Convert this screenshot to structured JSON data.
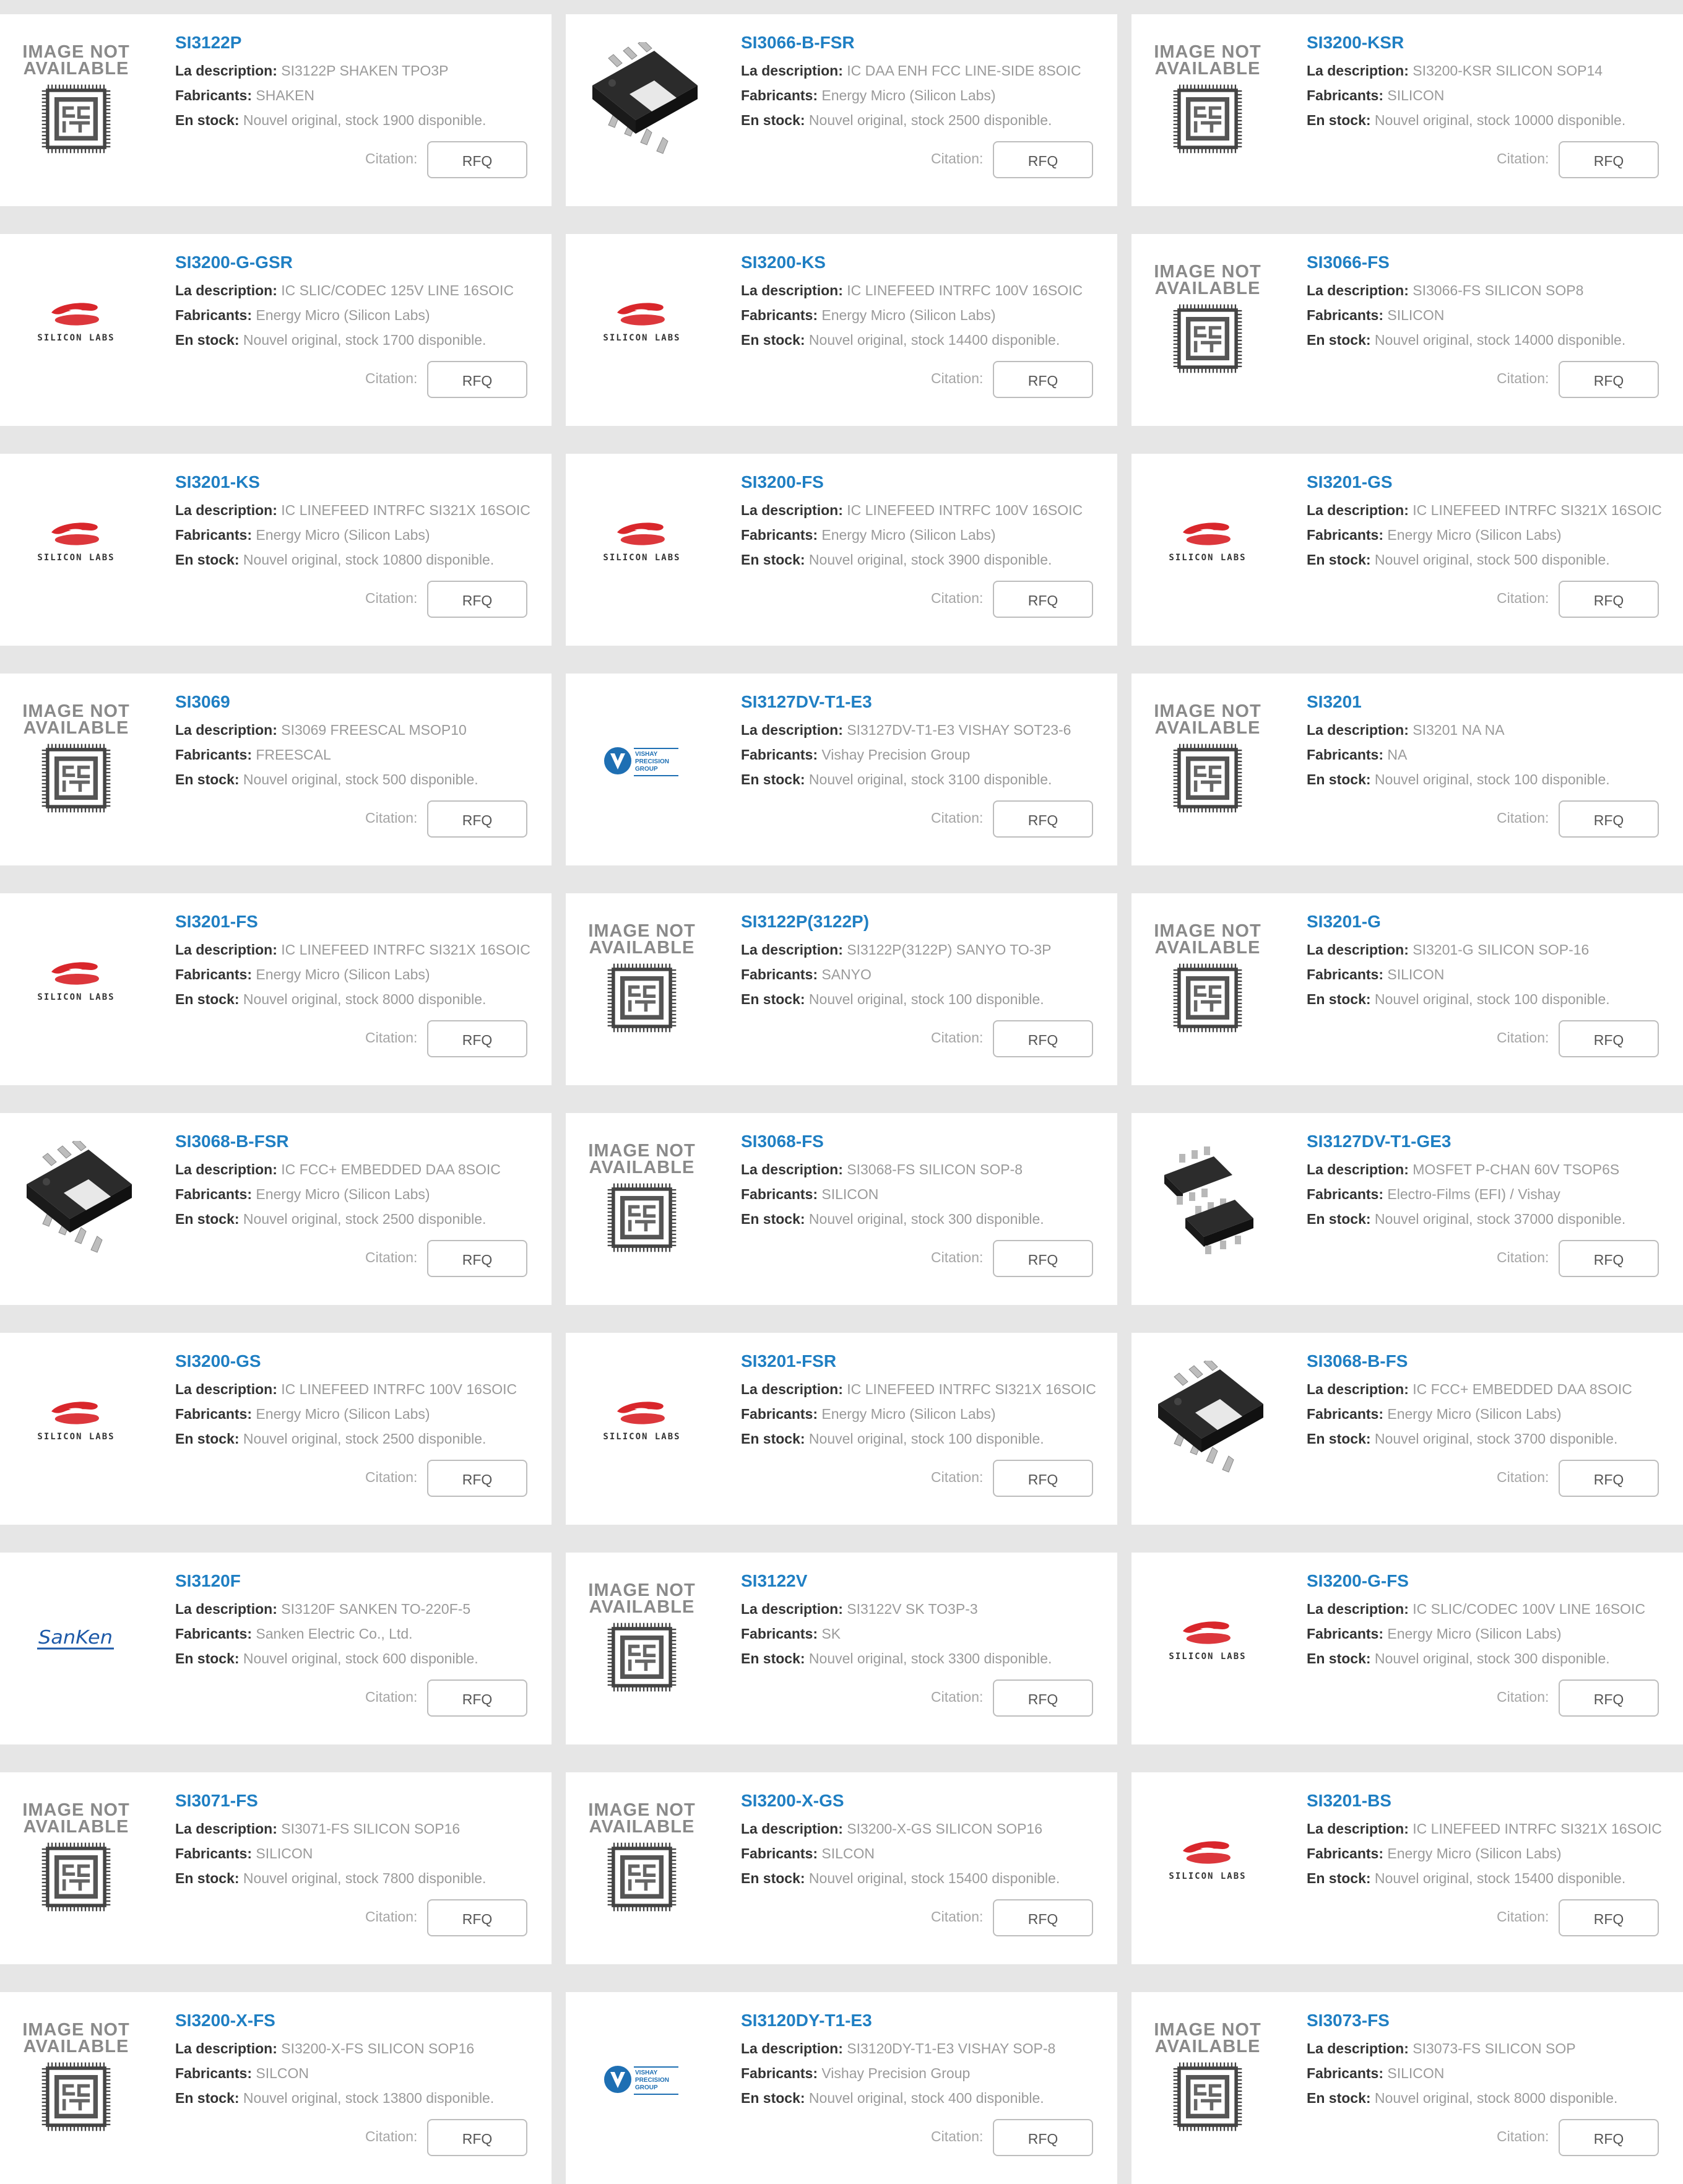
{
  "labels": {
    "description": "La description:",
    "manufacturers": "Fabricants:",
    "stock": "En stock:",
    "quote": "Citation:",
    "rfq": "RFQ",
    "image_na_line1": "IMAGE NOT",
    "image_na_line2": "AVAILABLE",
    "silicon_labs": "SILICON LABS",
    "sanken": "SanKen",
    "vishay_1": "VISHAY",
    "vishay_2": "PRECISION",
    "vishay_3": "GROUP"
  },
  "products": [
    {
      "pn": "SI3122P",
      "desc": "SI3122P SHAKEN TPO3P",
      "mfr": "SHAKEN",
      "stock": "Nouvel original, stock 1900 disponible.",
      "img": "na"
    },
    {
      "pn": "SI3066-B-FSR",
      "desc": "IC DAA ENH FCC LINE-SIDE 8SOIC",
      "mfr": "Energy Micro (Silicon Labs)",
      "stock": "Nouvel original, stock 2500 disponible.",
      "img": "soic"
    },
    {
      "pn": "SI3200-KSR",
      "desc": "SI3200-KSR SILICON SOP14",
      "mfr": "SILICON",
      "stock": "Nouvel original, stock 10000 disponible.",
      "img": "na"
    },
    {
      "pn": "SI3200-G-GSR",
      "desc": "IC SLIC/CODEC 125V LINE 16SOIC",
      "mfr": "Energy Micro (Silicon Labs)",
      "stock": "Nouvel original, stock 1700 disponible.",
      "img": "siliconlabs"
    },
    {
      "pn": "SI3200-KS",
      "desc": "IC LINEFEED INTRFC 100V 16SOIC",
      "mfr": "Energy Micro (Silicon Labs)",
      "stock": "Nouvel original, stock 14400 disponible.",
      "img": "siliconlabs"
    },
    {
      "pn": "SI3066-FS",
      "desc": "SI3066-FS SILICON SOP8",
      "mfr": "SILICON",
      "stock": "Nouvel original, stock 14000 disponible.",
      "img": "na"
    },
    {
      "pn": "SI3201-KS",
      "desc": "IC LINEFEED INTRFC SI321X 16SOIC",
      "mfr": "Energy Micro (Silicon Labs)",
      "stock": "Nouvel original, stock 10800 disponible.",
      "img": "siliconlabs"
    },
    {
      "pn": "SI3200-FS",
      "desc": "IC LINEFEED INTRFC 100V 16SOIC",
      "mfr": "Energy Micro (Silicon Labs)",
      "stock": "Nouvel original, stock 3900 disponible.",
      "img": "siliconlabs"
    },
    {
      "pn": "SI3201-GS",
      "desc": "IC LINEFEED INTRFC SI321X 16SOIC",
      "mfr": "Energy Micro (Silicon Labs)",
      "stock": "Nouvel original, stock 500 disponible.",
      "img": "siliconlabs"
    },
    {
      "pn": "SI3069",
      "desc": "SI3069 FREESCAL MSOP10",
      "mfr": "FREESCAL",
      "stock": "Nouvel original, stock 500 disponible.",
      "img": "na"
    },
    {
      "pn": "SI3127DV-T1-E3",
      "desc": "SI3127DV-T1-E3 VISHAY SOT23-6",
      "mfr": "Vishay Precision Group",
      "stock": "Nouvel original, stock 3100 disponible.",
      "img": "vishay"
    },
    {
      "pn": "SI3201",
      "desc": "SI3201 NA NA",
      "mfr": "NA",
      "stock": "Nouvel original, stock 100 disponible.",
      "img": "na"
    },
    {
      "pn": "SI3201-FS",
      "desc": "IC LINEFEED INTRFC SI321X 16SOIC",
      "mfr": "Energy Micro (Silicon Labs)",
      "stock": "Nouvel original, stock 8000 disponible.",
      "img": "siliconlabs"
    },
    {
      "pn": "SI3122P(3122P)",
      "desc": "SI3122P(3122P) SANYO TO-3P",
      "mfr": "SANYO",
      "stock": "Nouvel original, stock 100 disponible.",
      "img": "na"
    },
    {
      "pn": "SI3201-G",
      "desc": "SI3201-G SILICON SOP-16",
      "mfr": "SILICON",
      "stock": "Nouvel original, stock 100 disponible.",
      "img": "na"
    },
    {
      "pn": "SI3068-B-FSR",
      "desc": "IC FCC+ EMBEDDED DAA 8SOIC",
      "mfr": "Energy Micro (Silicon Labs)",
      "stock": "Nouvel original, stock 2500 disponible.",
      "img": "soic"
    },
    {
      "pn": "SI3068-FS",
      "desc": "SI3068-FS SILICON SOP-8",
      "mfr": "SILICON",
      "stock": "Nouvel original, stock 300 disponible.",
      "img": "na"
    },
    {
      "pn": "SI3127DV-T1-GE3",
      "desc": "MOSFET P-CHAN 60V TSOP6S",
      "mfr": "Electro-Films (EFI) / Vishay",
      "stock": "Nouvel original, stock 37000 disponible.",
      "img": "tsop"
    },
    {
      "pn": "SI3200-GS",
      "desc": "IC LINEFEED INTRFC 100V 16SOIC",
      "mfr": "Energy Micro (Silicon Labs)",
      "stock": "Nouvel original, stock 2500 disponible.",
      "img": "siliconlabs"
    },
    {
      "pn": "SI3201-FSR",
      "desc": "IC LINEFEED INTRFC SI321X 16SOIC",
      "mfr": "Energy Micro (Silicon Labs)",
      "stock": "Nouvel original, stock 100 disponible.",
      "img": "siliconlabs"
    },
    {
      "pn": "SI3068-B-FS",
      "desc": "IC FCC+ EMBEDDED DAA 8SOIC",
      "mfr": "Energy Micro (Silicon Labs)",
      "stock": "Nouvel original, stock 3700 disponible.",
      "img": "soic"
    },
    {
      "pn": "SI3120F",
      "desc": "SI3120F SANKEN TO-220F-5",
      "mfr": "Sanken Electric Co., Ltd.",
      "stock": "Nouvel original, stock 600 disponible.",
      "img": "sanken"
    },
    {
      "pn": "SI3122V",
      "desc": "SI3122V SK TO3P-3",
      "mfr": "SK",
      "stock": "Nouvel original, stock 3300 disponible.",
      "img": "na"
    },
    {
      "pn": "SI3200-G-FS",
      "desc": "IC SLIC/CODEC 100V LINE 16SOIC",
      "mfr": "Energy Micro (Silicon Labs)",
      "stock": "Nouvel original, stock 300 disponible.",
      "img": "siliconlabs"
    },
    {
      "pn": "SI3071-FS",
      "desc": "SI3071-FS SILICON SOP16",
      "mfr": "SILICON",
      "stock": "Nouvel original, stock 7800 disponible.",
      "img": "na"
    },
    {
      "pn": "SI3200-X-GS",
      "desc": "SI3200-X-GS SILICON SOP16",
      "mfr": "SILCON",
      "stock": "Nouvel original, stock 15400 disponible.",
      "img": "na"
    },
    {
      "pn": "SI3201-BS",
      "desc": "IC LINEFEED INTRFC SI321X 16SOIC",
      "mfr": "Energy Micro (Silicon Labs)",
      "stock": "Nouvel original, stock 15400 disponible.",
      "img": "siliconlabs"
    },
    {
      "pn": "SI3200-X-FS",
      "desc": "SI3200-X-FS SILICON SOP16",
      "mfr": "SILCON",
      "stock": "Nouvel original, stock 13800 disponible.",
      "img": "na"
    },
    {
      "pn": "SI3120DY-T1-E3",
      "desc": "SI3120DY-T1-E3 VISHAY SOP-8",
      "mfr": "Vishay Precision Group",
      "stock": "Nouvel original, stock 400 disponible.",
      "img": "vishay"
    },
    {
      "pn": "SI3073-FS",
      "desc": "SI3073-FS SILICON SOP",
      "mfr": "SILICON",
      "stock": "Nouvel original, stock 8000 disponible.",
      "img": "na"
    }
  ],
  "colors": {
    "page_bg": "#e6e6e6",
    "card_bg": "#ffffff",
    "part_number": "#1f7fc3",
    "label": "#333333",
    "value": "#9a9a9a",
    "silicon_labs_red": "#d9262b",
    "vishay_blue": "#1e6fb3",
    "sanken_blue": "#1e5aa8"
  }
}
